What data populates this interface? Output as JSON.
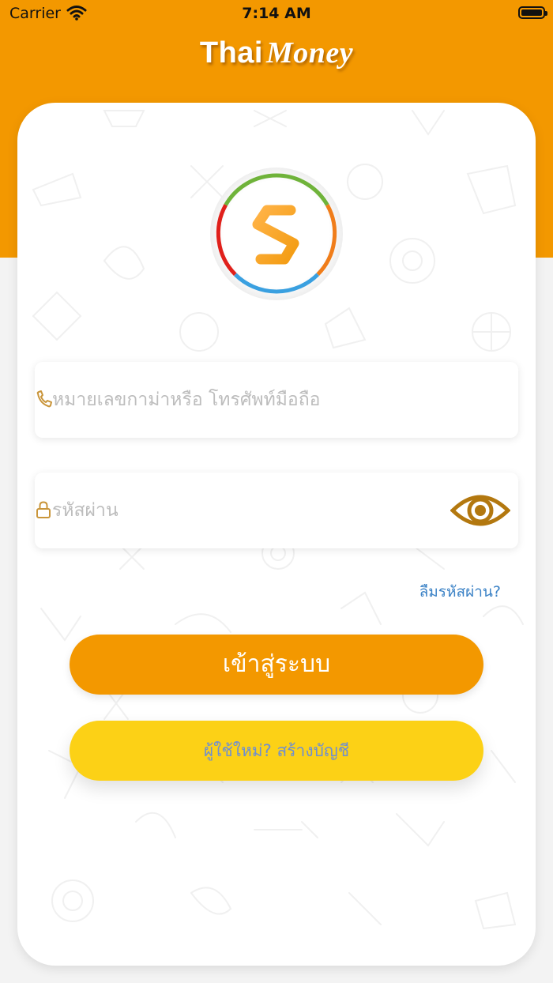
{
  "status_bar": {
    "carrier": "Carrier",
    "time": "7:14 AM"
  },
  "brand": {
    "part1": "Thai",
    "part2": "Money"
  },
  "login": {
    "phone_placeholder": "หมายเลขกาม่าหรือ โทรศัพท์มือถือ",
    "password_placeholder": "รหัสผ่าน",
    "forgot_password": "ลืมรหัสผ่าน?",
    "login_button": "เข้าสู่ระบบ",
    "register_button": "ผู้ใช้ใหม่? สร้างบัญชี"
  },
  "icons": {
    "phone": "phone-icon",
    "lock": "lock-icon",
    "eye": "eye-icon",
    "logo": "dollar-logo-icon"
  },
  "colors": {
    "header": "#F39800",
    "login_button": "#F39800",
    "register_button": "#FCD116",
    "link": "#3b82c6",
    "icon_gold": "#c9953a"
  }
}
